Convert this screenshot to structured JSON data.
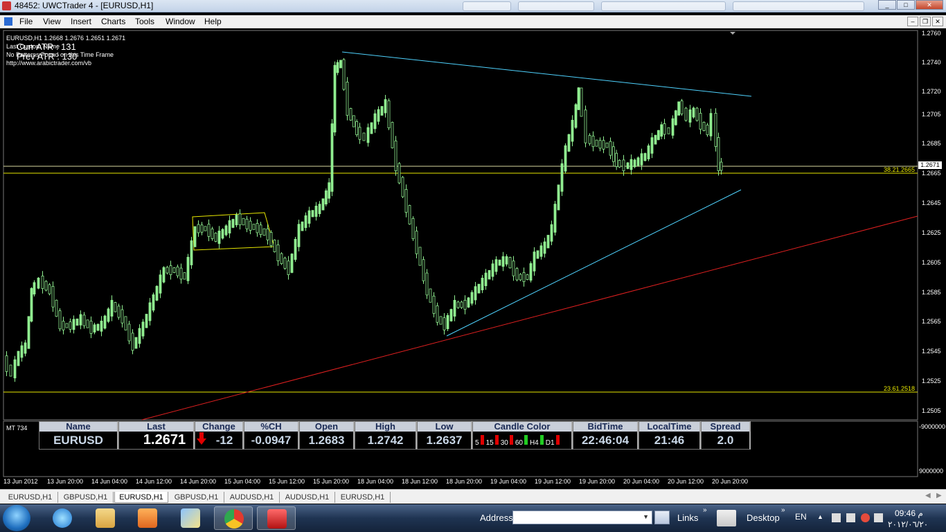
{
  "window": {
    "title": "48452: UWCTrader 4 - [EURUSD,H1]",
    "controls": [
      "_",
      "□",
      "✕"
    ]
  },
  "menu": {
    "items": [
      "File",
      "View",
      "Insert",
      "Charts",
      "Tools",
      "Window",
      "Help"
    ]
  },
  "chart": {
    "header": "EURUSD,H1  1.2668 1.2676 1.2651 1.2671",
    "info_lines": [
      "Last Custom Name",
      "No Patterns Found on this Time Frame",
      "http://www.arabictrader.com/vb"
    ],
    "curr_atr": "Curr ATR : 131",
    "prev_atr": "Prev ATR : 130",
    "current_price": "1.2671",
    "fib_upper": "38.21.2665",
    "fib_lower": "23.61.2518",
    "colors": {
      "bull": "#90ee90",
      "trendline_cyan": "#4fd3ff",
      "trendline_red": "#e02020",
      "fib_line": "#e8e800"
    },
    "price_axis": [
      "1.2760",
      "1.2740",
      "1.2720",
      "1.2705",
      "1.2685",
      "1.2665",
      "1.2645",
      "1.2625",
      "1.2605",
      "1.2585",
      "1.2565",
      "1.2545",
      "1.2525",
      "1.2505"
    ],
    "time_axis": [
      "13 Jun 2012",
      "13 Jun 20:00",
      "14 Jun 04:00",
      "14 Jun 12:00",
      "14 Jun 20:00",
      "15 Jun 04:00",
      "15 Jun 12:00",
      "15 Jun 20:00",
      "18 Jun 04:00",
      "18 Jun 12:00",
      "18 Jun 20:00",
      "19 Jun 04:00",
      "19 Jun 12:00",
      "19 Jun 20:00",
      "20 Jun 04:00",
      "20 Jun 12:00",
      "20 Jun 20:00"
    ]
  },
  "subwindow": {
    "label": "MT 734",
    "scale_top": "-9000000",
    "scale_bottom": "9000000"
  },
  "quote": {
    "headers": [
      "Name",
      "Last",
      "Change",
      "%CH",
      "Open",
      "High",
      "Low",
      "Candle Color",
      "BidTime",
      "LocalTime",
      "Spread"
    ],
    "name": "EURUSD",
    "last": "1.2671",
    "change": "-12",
    "pct_change": "-0.0947",
    "open": "1.2683",
    "high": "1.2742",
    "low": "1.2637",
    "candle_timeframes": [
      "5",
      "15",
      "30",
      "60",
      "H4",
      "D1"
    ],
    "candle_colors": [
      "#e00000",
      "#e00000",
      "#e00000",
      "#22cc22",
      "#22cc22",
      "#e00000"
    ],
    "bid_time": "22:46:04",
    "local_time": "21:46",
    "spread": "2.0"
  },
  "tabs": [
    "EURUSD,H1",
    "GBPUSD,H1",
    "EURUSD,H1",
    "GBPUSD,H1",
    "AUDUSD,H1",
    "AUDUSD,H1",
    "EURUSD,H1"
  ],
  "active_tab_index": 2,
  "taskbar": {
    "address_label": "Address",
    "links_label": "Links",
    "desktop_label": "Desktop",
    "language": "EN",
    "clock_time": "09:46 م",
    "clock_date": "٢٠١٢/٠٦/٢٠",
    "apps": [
      "internet-explorer-icon",
      "file-explorer-icon",
      "media-player-icon",
      "paint-icon",
      "chrome-icon",
      "trader-app-icon"
    ]
  }
}
